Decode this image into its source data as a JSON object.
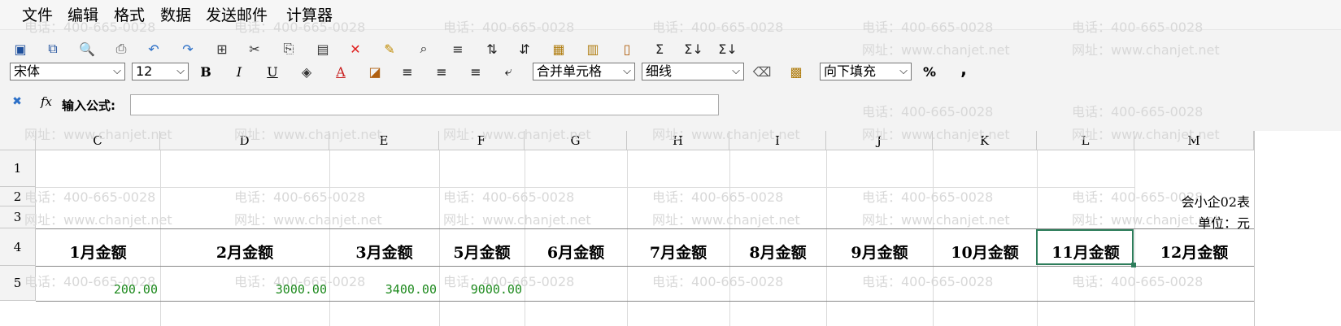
{
  "menu": [
    "文件",
    "编辑",
    "格式",
    "数据",
    "发送邮件",
    "计算器"
  ],
  "toolbar": {
    "font_name": "宋体",
    "font_size": "12",
    "merge": "合并单元格",
    "border": "细线",
    "fill": "向下填充",
    "percent": "%",
    "comma": ","
  },
  "formula": {
    "label": "输入公式:",
    "value": ""
  },
  "columns": [
    "C",
    "D",
    "E",
    "F",
    "G",
    "H",
    "I",
    "J",
    "K",
    "L",
    "M"
  ],
  "rows": [
    "1",
    "2",
    "3",
    "4",
    "5"
  ],
  "notes": {
    "table_code": "会小企02表",
    "unit": "单位：元"
  },
  "header_row": [
    "1月金额",
    "2月金额",
    "3月金额",
    "5月金额",
    "6月金额",
    "7月金额",
    "8月金额",
    "9月金额",
    "10月金额",
    "11月金额",
    "12月金额"
  ],
  "values": [
    "200.00",
    "3000.00",
    "3400.00",
    "9000.00"
  ],
  "watermark": {
    "phone": "电话：400-665-0028",
    "site": "网址：www.chanjet.net"
  },
  "selected_cell": "L4",
  "colors": {
    "value_green": "#1e8a1e",
    "selected_border": "#2e7d5b"
  }
}
